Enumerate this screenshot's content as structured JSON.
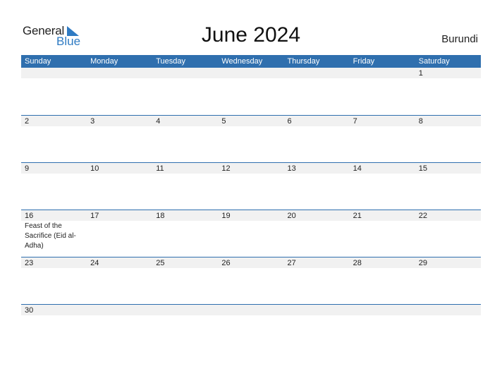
{
  "logo": {
    "general": "General",
    "blue": "Blue"
  },
  "header": {
    "title": "June 2024",
    "country": "Burundi"
  },
  "colors": {
    "accent": "#2f6fae",
    "band": "#f1f1f1",
    "logo_blue": "#2f7bc3"
  },
  "days": [
    "Sunday",
    "Monday",
    "Tuesday",
    "Wednesday",
    "Thursday",
    "Friday",
    "Saturday"
  ],
  "weeks": [
    [
      "",
      "",
      "",
      "",
      "",
      "",
      "1"
    ],
    [
      "2",
      "3",
      "4",
      "5",
      "6",
      "7",
      "8"
    ],
    [
      "9",
      "10",
      "11",
      "12",
      "13",
      "14",
      "15"
    ],
    [
      "16",
      "17",
      "18",
      "19",
      "20",
      "21",
      "22"
    ],
    [
      "23",
      "24",
      "25",
      "26",
      "27",
      "28",
      "29"
    ],
    [
      "30",
      "",
      "",
      "",
      "",
      "",
      ""
    ]
  ],
  "holidays": [
    {
      "week": 3,
      "day": 0,
      "name": "Feast of the Sacrifice (Eid al-Adha)"
    }
  ]
}
